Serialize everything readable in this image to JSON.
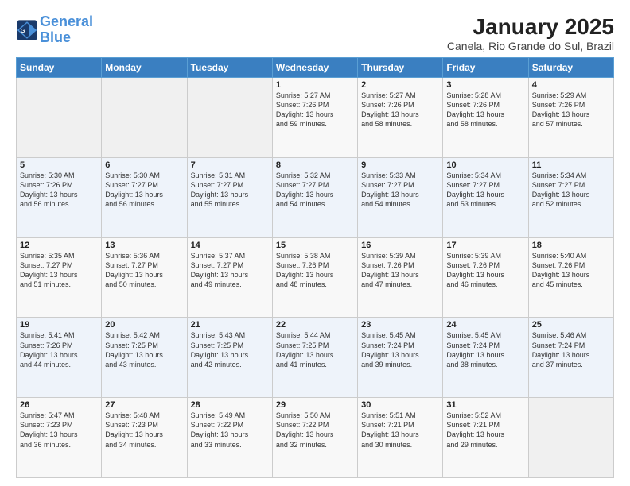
{
  "header": {
    "logo_line1": "General",
    "logo_line2": "Blue",
    "title": "January 2025",
    "subtitle": "Canela, Rio Grande do Sul, Brazil"
  },
  "weekdays": [
    "Sunday",
    "Monday",
    "Tuesday",
    "Wednesday",
    "Thursday",
    "Friday",
    "Saturday"
  ],
  "weeks": [
    [
      {
        "day": "",
        "info": ""
      },
      {
        "day": "",
        "info": ""
      },
      {
        "day": "",
        "info": ""
      },
      {
        "day": "1",
        "info": "Sunrise: 5:27 AM\nSunset: 7:26 PM\nDaylight: 13 hours\nand 59 minutes."
      },
      {
        "day": "2",
        "info": "Sunrise: 5:27 AM\nSunset: 7:26 PM\nDaylight: 13 hours\nand 58 minutes."
      },
      {
        "day": "3",
        "info": "Sunrise: 5:28 AM\nSunset: 7:26 PM\nDaylight: 13 hours\nand 58 minutes."
      },
      {
        "day": "4",
        "info": "Sunrise: 5:29 AM\nSunset: 7:26 PM\nDaylight: 13 hours\nand 57 minutes."
      }
    ],
    [
      {
        "day": "5",
        "info": "Sunrise: 5:30 AM\nSunset: 7:26 PM\nDaylight: 13 hours\nand 56 minutes."
      },
      {
        "day": "6",
        "info": "Sunrise: 5:30 AM\nSunset: 7:27 PM\nDaylight: 13 hours\nand 56 minutes."
      },
      {
        "day": "7",
        "info": "Sunrise: 5:31 AM\nSunset: 7:27 PM\nDaylight: 13 hours\nand 55 minutes."
      },
      {
        "day": "8",
        "info": "Sunrise: 5:32 AM\nSunset: 7:27 PM\nDaylight: 13 hours\nand 54 minutes."
      },
      {
        "day": "9",
        "info": "Sunrise: 5:33 AM\nSunset: 7:27 PM\nDaylight: 13 hours\nand 54 minutes."
      },
      {
        "day": "10",
        "info": "Sunrise: 5:34 AM\nSunset: 7:27 PM\nDaylight: 13 hours\nand 53 minutes."
      },
      {
        "day": "11",
        "info": "Sunrise: 5:34 AM\nSunset: 7:27 PM\nDaylight: 13 hours\nand 52 minutes."
      }
    ],
    [
      {
        "day": "12",
        "info": "Sunrise: 5:35 AM\nSunset: 7:27 PM\nDaylight: 13 hours\nand 51 minutes."
      },
      {
        "day": "13",
        "info": "Sunrise: 5:36 AM\nSunset: 7:27 PM\nDaylight: 13 hours\nand 50 minutes."
      },
      {
        "day": "14",
        "info": "Sunrise: 5:37 AM\nSunset: 7:27 PM\nDaylight: 13 hours\nand 49 minutes."
      },
      {
        "day": "15",
        "info": "Sunrise: 5:38 AM\nSunset: 7:26 PM\nDaylight: 13 hours\nand 48 minutes."
      },
      {
        "day": "16",
        "info": "Sunrise: 5:39 AM\nSunset: 7:26 PM\nDaylight: 13 hours\nand 47 minutes."
      },
      {
        "day": "17",
        "info": "Sunrise: 5:39 AM\nSunset: 7:26 PM\nDaylight: 13 hours\nand 46 minutes."
      },
      {
        "day": "18",
        "info": "Sunrise: 5:40 AM\nSunset: 7:26 PM\nDaylight: 13 hours\nand 45 minutes."
      }
    ],
    [
      {
        "day": "19",
        "info": "Sunrise: 5:41 AM\nSunset: 7:26 PM\nDaylight: 13 hours\nand 44 minutes."
      },
      {
        "day": "20",
        "info": "Sunrise: 5:42 AM\nSunset: 7:25 PM\nDaylight: 13 hours\nand 43 minutes."
      },
      {
        "day": "21",
        "info": "Sunrise: 5:43 AM\nSunset: 7:25 PM\nDaylight: 13 hours\nand 42 minutes."
      },
      {
        "day": "22",
        "info": "Sunrise: 5:44 AM\nSunset: 7:25 PM\nDaylight: 13 hours\nand 41 minutes."
      },
      {
        "day": "23",
        "info": "Sunrise: 5:45 AM\nSunset: 7:24 PM\nDaylight: 13 hours\nand 39 minutes."
      },
      {
        "day": "24",
        "info": "Sunrise: 5:45 AM\nSunset: 7:24 PM\nDaylight: 13 hours\nand 38 minutes."
      },
      {
        "day": "25",
        "info": "Sunrise: 5:46 AM\nSunset: 7:24 PM\nDaylight: 13 hours\nand 37 minutes."
      }
    ],
    [
      {
        "day": "26",
        "info": "Sunrise: 5:47 AM\nSunset: 7:23 PM\nDaylight: 13 hours\nand 36 minutes."
      },
      {
        "day": "27",
        "info": "Sunrise: 5:48 AM\nSunset: 7:23 PM\nDaylight: 13 hours\nand 34 minutes."
      },
      {
        "day": "28",
        "info": "Sunrise: 5:49 AM\nSunset: 7:22 PM\nDaylight: 13 hours\nand 33 minutes."
      },
      {
        "day": "29",
        "info": "Sunrise: 5:50 AM\nSunset: 7:22 PM\nDaylight: 13 hours\nand 32 minutes."
      },
      {
        "day": "30",
        "info": "Sunrise: 5:51 AM\nSunset: 7:21 PM\nDaylight: 13 hours\nand 30 minutes."
      },
      {
        "day": "31",
        "info": "Sunrise: 5:52 AM\nSunset: 7:21 PM\nDaylight: 13 hours\nand 29 minutes."
      },
      {
        "day": "",
        "info": ""
      }
    ]
  ]
}
